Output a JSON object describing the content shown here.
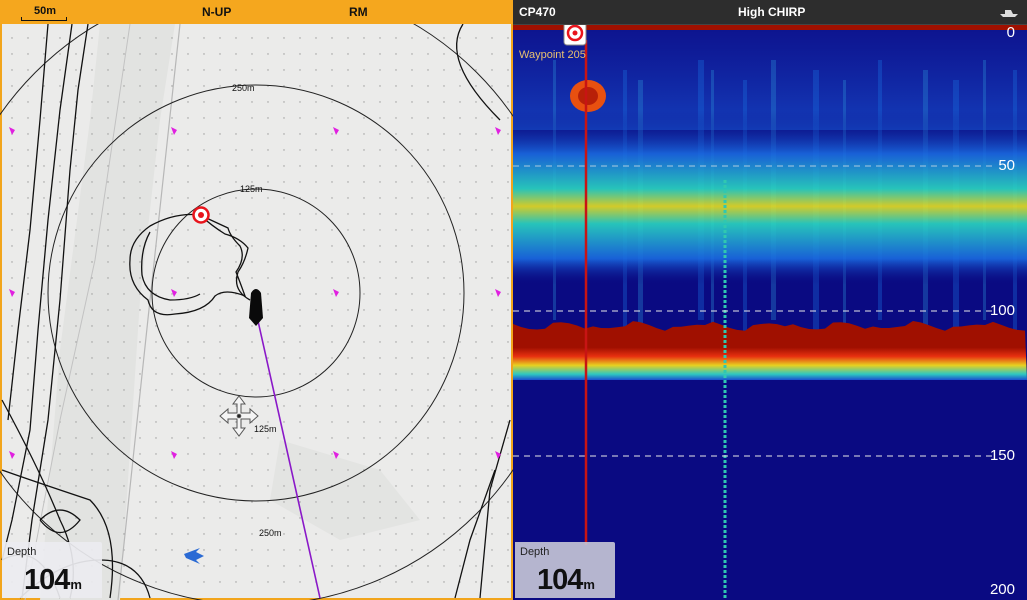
{
  "chart": {
    "scale": "50m",
    "orientation": "N-UP",
    "motion_mode": "RM",
    "range_rings": [
      "250m",
      "125m",
      "125m",
      "250m"
    ],
    "depth": {
      "label": "Depth",
      "value": "104",
      "unit": "m"
    },
    "colors": {
      "bar": "#f5a71e",
      "heading_line": "#8a18c8",
      "waypoint": "#e8141c",
      "marker": "#e020e0"
    }
  },
  "sonar": {
    "source": "CP470",
    "frequency": "High CHIRP",
    "waypoint_label": "Waypoint 205",
    "depth_scale": [
      "0",
      "50",
      "100",
      "150",
      "200"
    ],
    "depth": {
      "label": "Depth",
      "value": "104",
      "unit": "m"
    },
    "colors": {
      "background": "#0a0a82",
      "bottom": "#a01000",
      "cursor_line": "#c81414"
    }
  }
}
